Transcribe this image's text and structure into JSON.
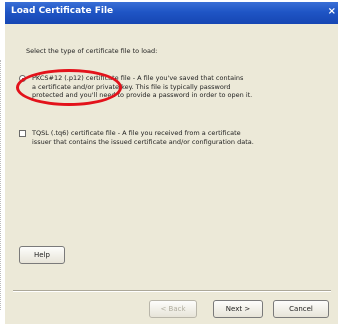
{
  "window": {
    "title": "Load Certificate File",
    "close_glyph": "×"
  },
  "instruction": "Select the type of certificate file to load:",
  "options": [
    {
      "type": "radio",
      "checked": true,
      "lines": [
        "PKCS#12 (.p12) certificate file - A file you've saved that contains",
        "a certificate and/or private key. This file is typically password",
        "protected and you'll need to provide a password in order to open it."
      ]
    },
    {
      "type": "checkbox",
      "checked": false,
      "lines": [
        "TQSL (.tq6) certificate file - A file you received from a certificate",
        "issuer that contains the issued certificate and/or configuration data."
      ]
    }
  ],
  "buttons": {
    "help": "Help",
    "back": "< Back",
    "next": "Next >",
    "cancel": "Cancel"
  },
  "annotation_color": "#e3121b"
}
